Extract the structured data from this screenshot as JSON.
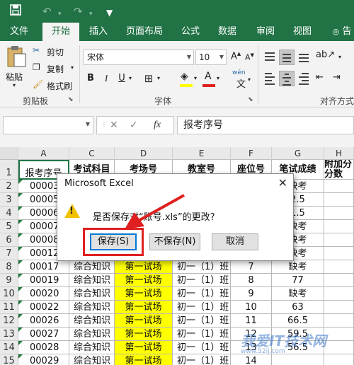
{
  "tabs": [
    "文件",
    "开始",
    "插入",
    "页面布局",
    "公式",
    "数据",
    "审阅",
    "视图",
    "告"
  ],
  "active_tab": "开始",
  "ribbon": {
    "clipboard": {
      "paste": "粘贴",
      "cut": "剪切",
      "copy": "复制",
      "painter": "格式刷",
      "group": "剪贴板"
    },
    "font": {
      "name": "宋体",
      "size": "10",
      "group": "字体",
      "bold": "B",
      "italic": "I",
      "underline": "U",
      "phonetic": "wén"
    },
    "align": {
      "group": "对齐方式"
    }
  },
  "formula_bar": {
    "name_box": "",
    "formula": "报考序号",
    "fx": "fx"
  },
  "columns": [
    "A",
    "C",
    "D",
    "E",
    "F",
    "G",
    "H"
  ],
  "headers": [
    "报考序号",
    "考试科目",
    "考场号",
    "教室号",
    "座位号",
    "笔试成绩",
    "附加分\n分数"
  ],
  "rows": [
    {
      "n": "1",
      "cells": [
        "报考序号",
        "考试科目",
        "考场号",
        "教室号",
        "座位号",
        "笔试成绩",
        "附加分"
      ]
    },
    {
      "n": "2",
      "cells": [
        "00003",
        "",
        "",
        "",
        "",
        "缺考",
        ""
      ]
    },
    {
      "n": "3",
      "cells": [
        "00005",
        "",
        "",
        "",
        "",
        "2.5",
        ""
      ]
    },
    {
      "n": "4",
      "cells": [
        "00006",
        "",
        "",
        "",
        "",
        "1.5",
        ""
      ]
    },
    {
      "n": "5",
      "cells": [
        "00007",
        "",
        "",
        "",
        "",
        "缺考",
        ""
      ]
    },
    {
      "n": "6",
      "cells": [
        "00008",
        "",
        "",
        "",
        "",
        "缺考",
        ""
      ]
    },
    {
      "n": "7",
      "cells": [
        "00012",
        "",
        "",
        "",
        "",
        "缺考",
        ""
      ]
    },
    {
      "n": "8",
      "cells": [
        "00017",
        "综合知识",
        "第一试场",
        "初一（1）班",
        "7",
        "缺考",
        ""
      ]
    },
    {
      "n": "9",
      "cells": [
        "00019",
        "综合知识",
        "第一试场",
        "初一（1）班",
        "8",
        "77",
        ""
      ]
    },
    {
      "n": "10",
      "cells": [
        "00020",
        "综合知识",
        "第一试场",
        "初一（1）班",
        "9",
        "缺考",
        ""
      ]
    },
    {
      "n": "11",
      "cells": [
        "00022",
        "综合知识",
        "第一试场",
        "初一（1）班",
        "10",
        "63",
        ""
      ]
    },
    {
      "n": "12",
      "cells": [
        "00026",
        "综合知识",
        "第一试场",
        "初一（1）班",
        "11",
        "66.5",
        ""
      ]
    },
    {
      "n": "13",
      "cells": [
        "00027",
        "综合知识",
        "第一试场",
        "初一（1）班",
        "12",
        "59.5",
        ""
      ]
    },
    {
      "n": "14",
      "cells": [
        "00028",
        "综合知识",
        "第一试场",
        "初一（1）班",
        "13",
        "56.5",
        ""
      ]
    },
    {
      "n": "15",
      "cells": [
        "00029",
        "综合知识",
        "第一试场",
        "初一（1）班",
        "14",
        "",
        ""
      ]
    }
  ],
  "dialog": {
    "title": "Microsoft Excel",
    "close": "✕",
    "message": "是否保存对“账号.xls”的更改?",
    "buttons": {
      "save": "保存(S)",
      "dont_save": "不保存(N)",
      "cancel": "取消"
    }
  },
  "watermark": {
    "text": "我爱IT技术网",
    "sub": "www.52ij.com"
  },
  "colors": {
    "excel_green": "#217346",
    "yellow": "#ffff00",
    "highlight_red": "#e02020",
    "default_blue": "#0078d7"
  }
}
